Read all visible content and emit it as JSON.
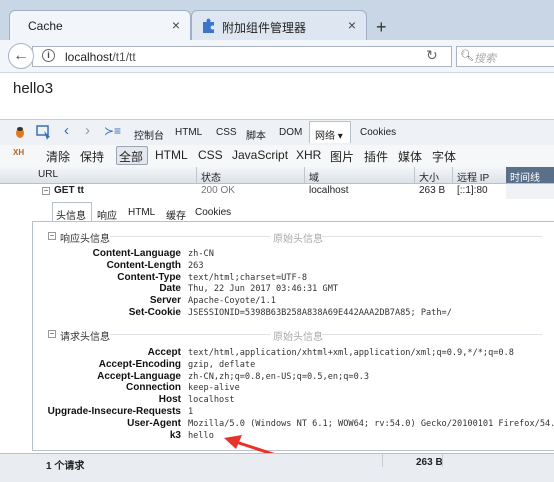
{
  "tabs": [
    {
      "title": "Cache",
      "close": "×"
    },
    {
      "title": "附加组件管理器",
      "close": "×"
    }
  ],
  "new_tab": "+",
  "navbar": {
    "url_host": "localhost",
    "url_path": "/t1/tt",
    "search_placeholder": "搜索"
  },
  "page": {
    "body_text": "hello3"
  },
  "firebug": {
    "toolbar": [
      "控制台",
      "HTML",
      "CSS",
      "脚本",
      "DOM",
      "网络 ▾",
      "Cookies"
    ],
    "filters": [
      "清除",
      "保持",
      "全部",
      "HTML",
      "CSS",
      "JavaScript",
      "XHR",
      "图片",
      "插件",
      "媒体",
      "字体"
    ],
    "columns": [
      "URL",
      "状态",
      "域",
      "大小",
      "远程 IP",
      "时间线"
    ],
    "request": {
      "url": "GET tt",
      "status": "200 OK",
      "domain": "localhost",
      "size": "263 B",
      "remote_ip": "[::1]:80"
    },
    "subtabs": [
      "头信息",
      "响应",
      "HTML",
      "缓存",
      "Cookies"
    ],
    "response_headers_title": "响应头信息",
    "request_headers_title": "请求头信息",
    "raw_label": "原始头信息",
    "response_headers": [
      {
        "name": "Content-Language",
        "value": "zh-CN"
      },
      {
        "name": "Content-Length",
        "value": "263"
      },
      {
        "name": "Content-Type",
        "value": "text/html;charset=UTF-8"
      },
      {
        "name": "Date",
        "value": "Thu, 22 Jun 2017 03:46:31 GMT"
      },
      {
        "name": "Server",
        "value": "Apache-Coyote/1.1"
      },
      {
        "name": "Set-Cookie",
        "value": "JSESSIONID=5398B63B258A838A69E442AAA2DB7A85; Path=/"
      }
    ],
    "request_headers": [
      {
        "name": "Accept",
        "value": "text/html,application/xhtml+xml,application/xml;q=0.9,*/*;q=0.8"
      },
      {
        "name": "Accept-Encoding",
        "value": "gzip, deflate"
      },
      {
        "name": "Accept-Language",
        "value": "zh-CN,zh;q=0.8,en-US;q=0.5,en;q=0.3"
      },
      {
        "name": "Connection",
        "value": "keep-alive"
      },
      {
        "name": "Host",
        "value": "localhost"
      },
      {
        "name": "Upgrade-Insecure-Requests",
        "value": "1"
      },
      {
        "name": "User-Agent",
        "value": "Mozilla/5.0 (Windows NT 6.1; WOW64; rv:54.0) Gecko/20100101 Firefox/54.0"
      },
      {
        "name": "k3",
        "value": "hello"
      }
    ],
    "status_count": "1 个请求",
    "status_size": "263 B"
  },
  "colors": {
    "tabbar": "#c9d6e6",
    "annotation_arrow": "#e8322a",
    "timeline_header": "#5a6f8a"
  }
}
